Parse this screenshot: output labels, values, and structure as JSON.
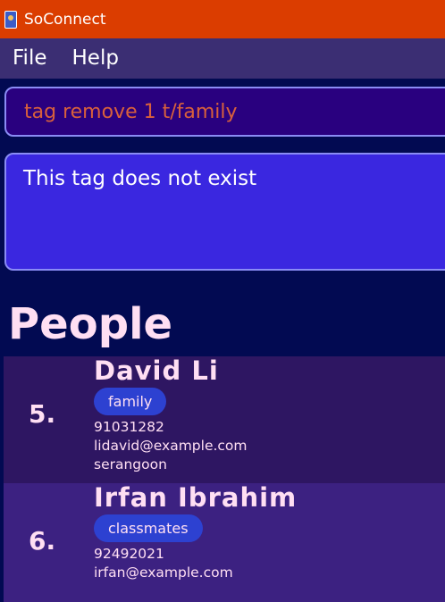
{
  "window": {
    "title": "SoConnect"
  },
  "menu": {
    "file": "File",
    "help": "Help"
  },
  "command": {
    "value": "tag remove 1 t/family"
  },
  "result": {
    "message": "This tag does not exist"
  },
  "people": {
    "heading": "People",
    "items": [
      {
        "index": "5.",
        "name": "David Li",
        "tags": [
          "family"
        ],
        "phone": "91031282",
        "email": "lidavid@example.com",
        "address": "serangoon"
      },
      {
        "index": "6.",
        "name": "Irfan Ibrahim",
        "tags": [
          "classmates"
        ],
        "phone": "92492021",
        "email": "irfan@example.com",
        "address": ""
      }
    ]
  },
  "colors": {
    "titlebar": "#db3d00",
    "menubar": "#3b2e73",
    "background": "#020a52",
    "command_box": "#29007f",
    "result_box": "#3a27e0",
    "tag": "#2d41d1"
  }
}
